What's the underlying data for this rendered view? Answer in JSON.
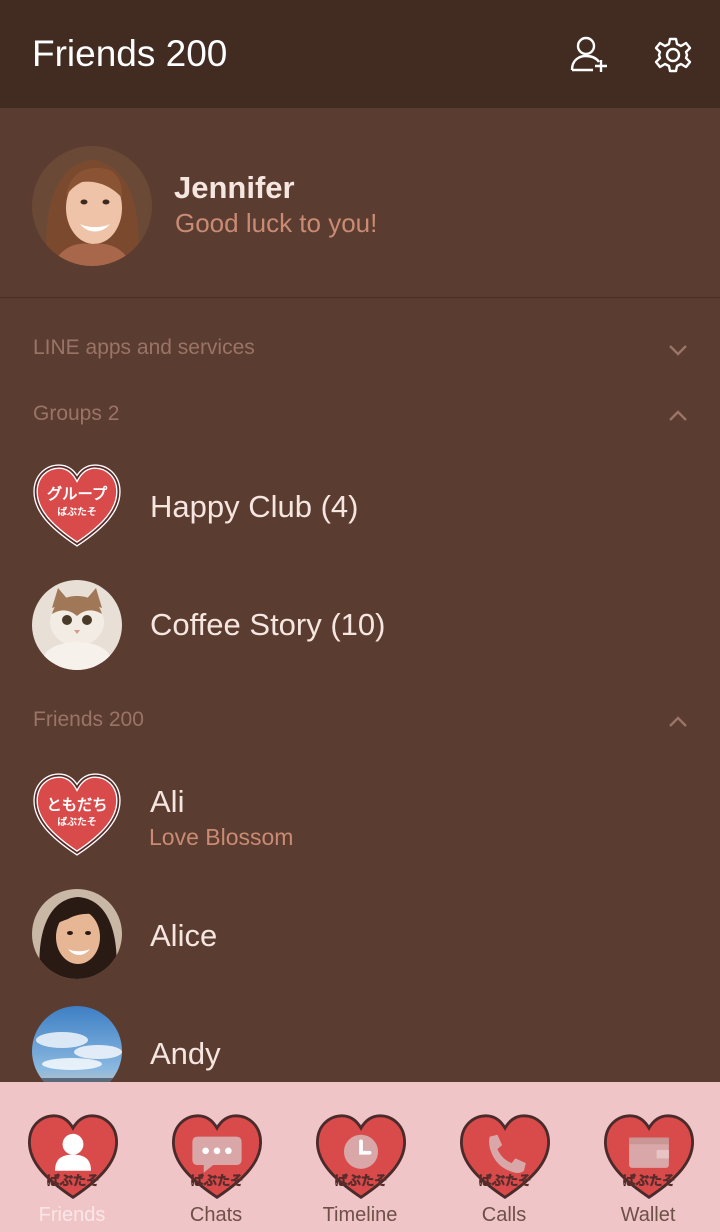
{
  "header": {
    "title": "Friends 200",
    "add_friend_icon": "add-friend-icon",
    "settings_icon": "gear-icon"
  },
  "profile": {
    "name": "Jennifer",
    "status": "Good luck to you!"
  },
  "sections": {
    "apps": {
      "label": "LINE apps and services",
      "state": "collapsed"
    },
    "groups": {
      "label": "Groups 2",
      "state": "expanded"
    },
    "friends": {
      "label": "Friends 200",
      "state": "expanded"
    }
  },
  "groups": [
    {
      "name": "Happy Club (4)",
      "heart_text": "グループ",
      "heart_sub": "ばぶたそ"
    },
    {
      "name": "Coffee Story (10)"
    }
  ],
  "friends": [
    {
      "name": "Ali",
      "status": "Love Blossom",
      "heart_text": "ともだち",
      "heart_sub": "ばぶたそ"
    },
    {
      "name": "Alice"
    },
    {
      "name": "Andy"
    }
  ],
  "tabs": [
    {
      "label": "Friends",
      "icon": "person-icon",
      "active": true,
      "heart_sub": "ばぶたそ"
    },
    {
      "label": "Chats",
      "icon": "chat-icon",
      "active": false,
      "heart_sub": "ばぶたそ"
    },
    {
      "label": "Timeline",
      "icon": "clock-icon",
      "active": false,
      "heart_sub": "ばぶたそ"
    },
    {
      "label": "Calls",
      "icon": "phone-icon",
      "active": false,
      "heart_sub": "ばぶたそ"
    },
    {
      "label": "Wallet",
      "icon": "wallet-icon",
      "active": false,
      "heart_sub": "ばぶたそ"
    }
  ],
  "colors": {
    "header_bg": "#422b21",
    "body_bg": "#5b3c30",
    "tabbar_bg": "#f0c5c7",
    "heart_red": "#d94a4a",
    "accent_text": "#c98b74"
  }
}
